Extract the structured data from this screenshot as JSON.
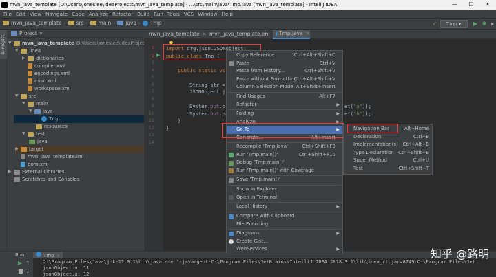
{
  "window": {
    "title": "mvn_java_template [D:\\Users\\joneslee\\IdeaProjects\\mvn_java_template] - ...\\src\\main\\java\\Tmp.java [mvn_java_template] - IntelliJ IDEA",
    "minimize": "—",
    "maximize": "☐",
    "close": "✕"
  },
  "menubar": [
    "File",
    "Edit",
    "View",
    "Navigate",
    "Code",
    "Analyze",
    "Refactor",
    "Build",
    "Run",
    "Tools",
    "VCS",
    "Window",
    "Help"
  ],
  "breadcrumb": [
    "mvn_java_template",
    "src",
    "main",
    "java",
    "Tmp"
  ],
  "run_config": "Tmp",
  "project_panel": {
    "title": "Project",
    "strip_label": "1: Project",
    "tree": [
      {
        "label": "mvn_java_template",
        "extra": "D:\\Users\\joneslee\\IdeaProject"
      },
      {
        "label": ".idea"
      },
      {
        "label": "dictionaries"
      },
      {
        "label": "compiler.xml"
      },
      {
        "label": "encodings.xml"
      },
      {
        "label": "misc.xml"
      },
      {
        "label": "workspace.xml"
      },
      {
        "label": "src"
      },
      {
        "label": "main"
      },
      {
        "label": "java"
      },
      {
        "label": "Tmp"
      },
      {
        "label": "resources"
      },
      {
        "label": "test"
      },
      {
        "label": "java"
      },
      {
        "label": "target"
      },
      {
        "label": "mvn_java_template.iml"
      },
      {
        "label": "pom.xml"
      },
      {
        "label": "External Libraries"
      },
      {
        "label": "Scratches and Consoles"
      }
    ]
  },
  "tabs": [
    {
      "label": "mvn_java_template"
    },
    {
      "label": "mvn_java_template.iml"
    },
    {
      "label": "Tmp.java"
    }
  ],
  "editor": {
    "line_numbers": [
      "1",
      "2",
      "3",
      "4",
      "5",
      "6",
      "7",
      "8",
      "9",
      "10",
      "11",
      "12",
      "13",
      "14"
    ],
    "line1_kw": "import",
    "line1_rest": " org.json.JSONObject;",
    "line2_kw": "public class",
    "line2_rest": " Tmp {",
    "line4": "public static vo",
    "line6_a": "String str =",
    "line7_a": "JSONObject j",
    "line9_a": "System.",
    "line9_field": "out",
    "line9_b": ".p",
    "line9_tail_a": "et(",
    "line9_tail_str": "\"a\"",
    "line9_tail_b": "));",
    "line10_a": "System.",
    "line10_field": "out",
    "line10_b": ".p",
    "line10_tail_a": "et(",
    "line10_tail_str": "\"b\"",
    "line10_tail_b": "));",
    "line11": "}",
    "line12": "}"
  },
  "context_menu": [
    {
      "label": "Copy Reference",
      "shortcut": "Ctrl+Alt+Shift+C"
    },
    {
      "label": "Paste",
      "shortcut": "Ctrl+V"
    },
    {
      "label": "Paste from History...",
      "shortcut": "Ctrl+Shift+V"
    },
    {
      "label": "Paste without Formatting",
      "shortcut": "Ctrl+Alt+Shift+V"
    },
    {
      "label": "Column Selection Mode",
      "shortcut": "Alt+Shift+Insert"
    },
    {
      "label": "Find Usages",
      "shortcut": "Alt+F7"
    },
    {
      "label": "Refactor",
      "shortcut": ""
    },
    {
      "label": "Folding",
      "shortcut": ""
    },
    {
      "label": "Analyze",
      "shortcut": ""
    },
    {
      "label": "Go To",
      "shortcut": ""
    },
    {
      "label": "Generate...",
      "shortcut": "Alt+Insert"
    },
    {
      "label": "Recompile 'Tmp.java'",
      "shortcut": "Ctrl+Shift+F9"
    },
    {
      "label": "Run 'Tmp.main()'",
      "shortcut": "Ctrl+Shift+F10"
    },
    {
      "label": "Debug 'Tmp.main()'",
      "shortcut": ""
    },
    {
      "label": "Run 'Tmp.main()' with Coverage",
      "shortcut": ""
    },
    {
      "label": "Save 'Tmp.main()'",
      "shortcut": ""
    },
    {
      "label": "Show in Explorer",
      "shortcut": ""
    },
    {
      "label": "Open in Terminal",
      "shortcut": ""
    },
    {
      "label": "Local History",
      "shortcut": ""
    },
    {
      "label": "Compare with Clipboard",
      "shortcut": ""
    },
    {
      "label": "File Encoding",
      "shortcut": ""
    },
    {
      "label": "Diagrams",
      "shortcut": ""
    },
    {
      "label": "Create Gist...",
      "shortcut": ""
    },
    {
      "label": "WebServices",
      "shortcut": ""
    }
  ],
  "submenu": [
    {
      "label": "Navigation Bar",
      "shortcut": "Alt+Home"
    },
    {
      "label": "Declaration",
      "shortcut": "Ctrl+B"
    },
    {
      "label": "Implementation(s)",
      "shortcut": "Ctrl+Alt+B"
    },
    {
      "label": "Type Declaration",
      "shortcut": "Ctrl+Shift+B"
    },
    {
      "label": "Super Method",
      "shortcut": "Ctrl+U"
    },
    {
      "label": "Test",
      "shortcut": "Ctrl+Shift+T"
    }
  ],
  "run_panel": {
    "label": "Run:",
    "tab": "Tmp",
    "output": [
      "D:\\Program_Files\\Java\\jdk-12.0.1\\bin\\java.exe \"-javaagent:C:\\Program Files\\JetBrains\\IntelliJ IDEA 2018.3.1\\lib\\idea_rt.jar=8749:C:\\Program Files\\Jet",
      "jsonObject.a: 11",
      "jsonObject.a: 12"
    ]
  },
  "watermark": "知乎 @路明",
  "colors": {
    "accent": "#4b6eaf",
    "highlight_box": "#ff3333"
  }
}
